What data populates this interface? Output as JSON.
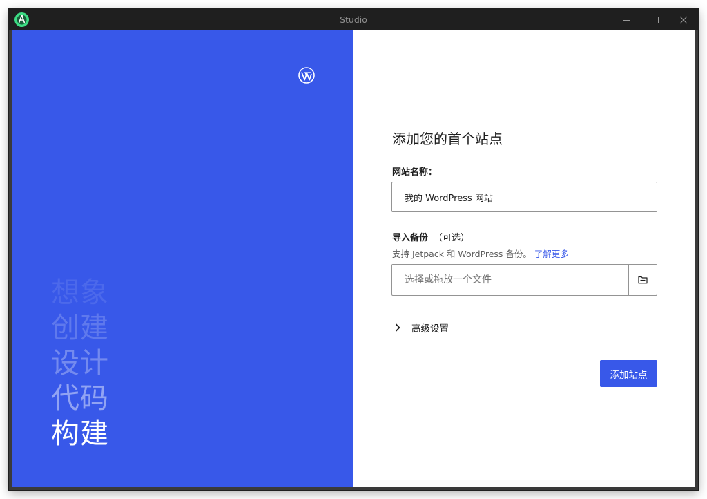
{
  "window": {
    "title": "Studio"
  },
  "brand": {
    "accent": "#3858e9",
    "titlebar_bg": "#1f1f1f",
    "app_icon": "android-studio-icon",
    "logo_icon": "wordpress-logo-icon"
  },
  "left_panel": {
    "taglines": [
      "想象",
      "创建",
      "设计",
      "代码",
      "构建"
    ]
  },
  "form": {
    "title": "添加您的首个站点",
    "site_name_label": "网站名称：",
    "site_name_value": "我的 WordPress 网站",
    "import_label": "导入备份",
    "import_optional": "（可选）",
    "import_helper": "支持 Jetpack 和 WordPress 备份。",
    "learn_more": "了解更多",
    "file_placeholder": "选择或拖放一个文件",
    "file_button_icon": "folder-icon",
    "advanced_settings": "高级设置",
    "submit_label": "添加站点"
  }
}
